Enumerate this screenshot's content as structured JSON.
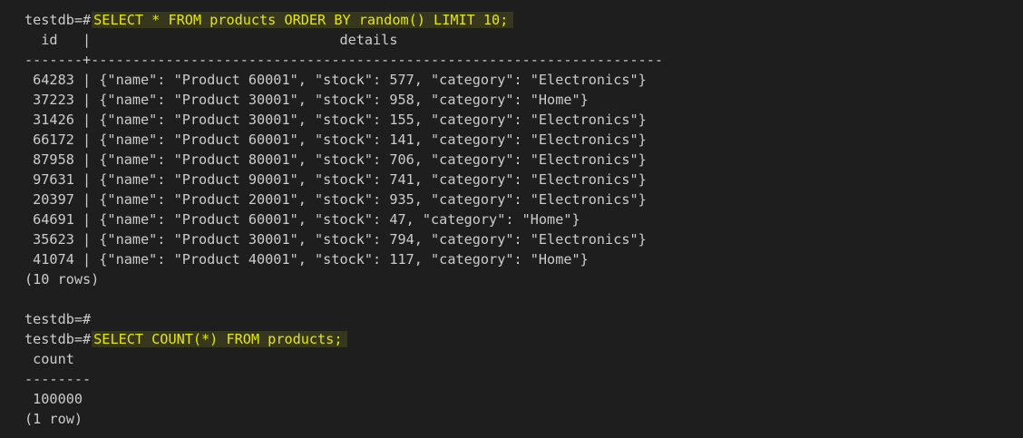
{
  "prompt": "testdb=#",
  "query1": {
    "command": "SELECT * FROM products ORDER BY random() LIMIT 10;",
    "header": "  id   |                              details",
    "separator": "-------+---------------------------------------------------------------------",
    "rows": [
      " 64283 | {\"name\": \"Product 60001\", \"stock\": 577, \"category\": \"Electronics\"}",
      " 37223 | {\"name\": \"Product 30001\", \"stock\": 958, \"category\": \"Home\"}",
      " 31426 | {\"name\": \"Product 30001\", \"stock\": 155, \"category\": \"Electronics\"}",
      " 66172 | {\"name\": \"Product 60001\", \"stock\": 141, \"category\": \"Electronics\"}",
      " 87958 | {\"name\": \"Product 80001\", \"stock\": 706, \"category\": \"Electronics\"}",
      " 97631 | {\"name\": \"Product 90001\", \"stock\": 741, \"category\": \"Electronics\"}",
      " 20397 | {\"name\": \"Product 20001\", \"stock\": 935, \"category\": \"Electronics\"}",
      " 64691 | {\"name\": \"Product 60001\", \"stock\": 47, \"category\": \"Home\"}",
      " 35623 | {\"name\": \"Product 30001\", \"stock\": 794, \"category\": \"Electronics\"}",
      " 41074 | {\"name\": \"Product 40001\", \"stock\": 117, \"category\": \"Home\"}"
    ],
    "footer": "(10 rows)"
  },
  "empty_prompt": "testdb=#",
  "query2": {
    "command": "SELECT COUNT(*) FROM products;",
    "header": " count",
    "separator": "--------",
    "rows": [
      " 100000"
    ],
    "footer": "(1 row)"
  },
  "colors": {
    "background": "#1e1e1e",
    "text": "#cccccc",
    "command_text": "#e5e510",
    "command_highlight": "#37371e"
  }
}
